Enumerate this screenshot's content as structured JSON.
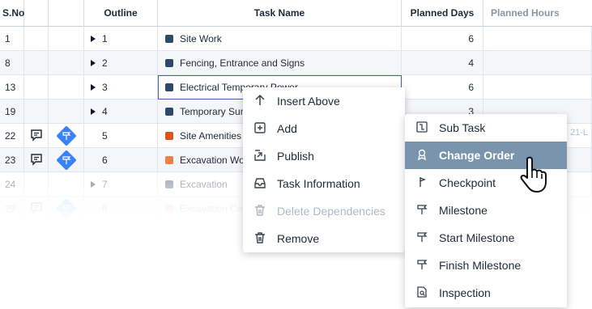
{
  "grid": {
    "headers": {
      "sno": "S.No",
      "outline": "Outline",
      "task_name": "Task Name",
      "planned_days": "Planned Days",
      "planned_hours": "Planned Hours"
    },
    "rows": [
      {
        "sno": "1",
        "outline": "1",
        "task": "Site Work",
        "days": "6",
        "color": "#2e4a6b",
        "expand": true,
        "note": false,
        "milestone": false
      },
      {
        "sno": "8",
        "outline": "2",
        "task": "Fencing, Entrance and Signs",
        "days": "4",
        "color": "#2e4a6b",
        "expand": true,
        "note": false,
        "milestone": false
      },
      {
        "sno": "13",
        "outline": "3",
        "task": "Electrical Temporary Power",
        "days": "6",
        "color": "#2e4a6b",
        "expand": true,
        "note": false,
        "milestone": false
      },
      {
        "sno": "19",
        "outline": "4",
        "task": "Temporary Sumps",
        "days": "3",
        "color": "#2e4a6b",
        "expand": true,
        "note": false,
        "milestone": false
      },
      {
        "sno": "22",
        "outline": "5",
        "task": "Site Amenities",
        "days": "",
        "color": "#e0541c",
        "expand": false,
        "note": true,
        "milestone": true
      },
      {
        "sno": "23",
        "outline": "6",
        "task": "Excavation Works",
        "days": "",
        "color": "#e8824a",
        "expand": false,
        "note": true,
        "milestone": true
      },
      {
        "sno": "24",
        "outline": "7",
        "task": "Excavation",
        "days": "",
        "color": "#2e4a6b",
        "expand": true,
        "note": false,
        "milestone": false
      },
      {
        "sno": "29",
        "outline": "8",
        "task": "Excavation Complete",
        "days": "",
        "color": "#e8824a",
        "expand": false,
        "note": true,
        "milestone": true
      }
    ],
    "ghost_text": "21-L"
  },
  "context_menu": {
    "items": [
      {
        "label": "Insert Above",
        "icon": "arrow-up-icon",
        "disabled": false
      },
      {
        "label": "Add",
        "icon": "plus-box-icon",
        "disabled": false
      },
      {
        "label": "Publish",
        "icon": "publish-icon",
        "disabled": false
      },
      {
        "label": "Task Information",
        "icon": "inbox-icon",
        "disabled": false
      },
      {
        "label": "Delete Dependencies",
        "icon": "trash-icon",
        "disabled": true
      },
      {
        "label": "Remove",
        "icon": "trash-icon",
        "disabled": false
      }
    ]
  },
  "submenu": {
    "items": [
      {
        "label": "Sub Task",
        "icon": "subtask-icon",
        "active": false
      },
      {
        "label": "Change Order",
        "icon": "change-order-icon",
        "active": true
      },
      {
        "label": "Checkpoint",
        "icon": "checkpoint-icon",
        "active": false
      },
      {
        "label": "Milestone",
        "icon": "milestone-icon",
        "active": false
      },
      {
        "label": "Start Milestone",
        "icon": "start-milestone-icon",
        "active": false
      },
      {
        "label": "Finish Milestone",
        "icon": "finish-milestone-icon",
        "active": false
      },
      {
        "label": "Inspection",
        "icon": "inspection-icon",
        "active": false
      }
    ]
  },
  "colors": {
    "accent": "#7b94ad",
    "milestone": "#3b82f6",
    "selection": "#3a63a8"
  }
}
